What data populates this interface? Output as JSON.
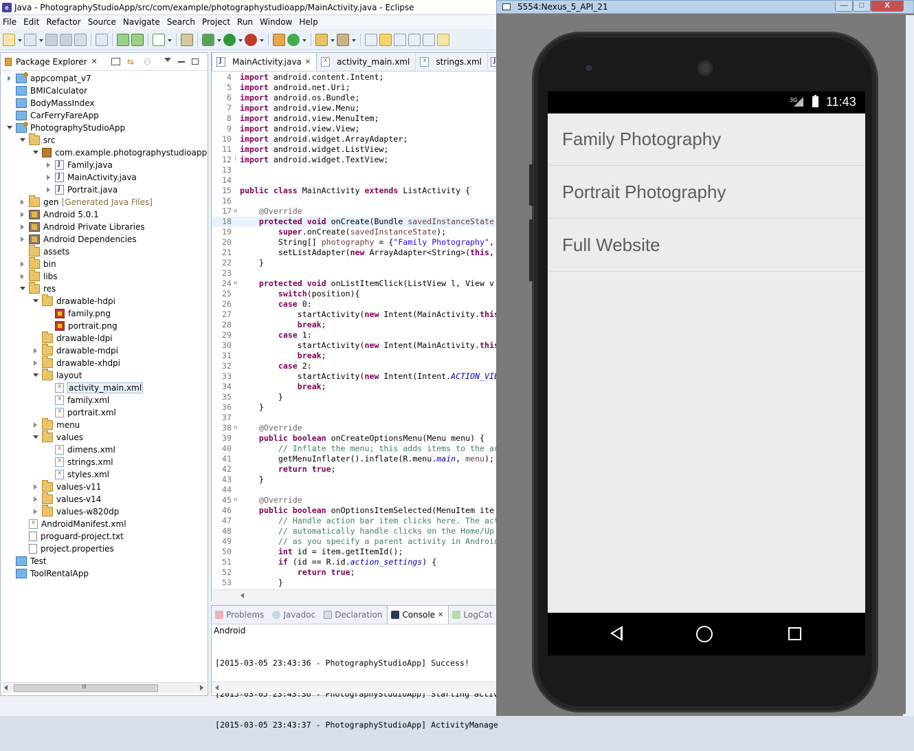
{
  "eclipse": {
    "title": "Java - PhotographyStudioApp/src/com/example/photographystudioapp/MainActivity.java - Eclipse",
    "menu": [
      "File",
      "Edit",
      "Refactor",
      "Source",
      "Navigate",
      "Search",
      "Project",
      "Run",
      "Window",
      "Help"
    ],
    "package_explorer": {
      "title": "Package Explorer",
      "tree": [
        {
          "label": "appcompat_v7",
          "icon": "project-icon"
        },
        {
          "label": "BMICalculator",
          "icon": "folder-icon"
        },
        {
          "label": "BodyMassIndex",
          "icon": "folder-icon"
        },
        {
          "label": "CarFerryFareApp",
          "icon": "folder-icon"
        },
        {
          "label": "PhotographyStudioApp",
          "icon": "project-icon"
        },
        {
          "label": "src",
          "icon": "source-folder-icon"
        },
        {
          "label": "com.example.photographystudioapp",
          "icon": "package-icon"
        },
        {
          "label": "Family.java",
          "icon": "java-file-icon"
        },
        {
          "label": "MainActivity.java",
          "icon": "java-file-icon"
        },
        {
          "label": "Portrait.java",
          "icon": "java-file-icon"
        },
        {
          "label": "gen",
          "icon": "source-folder-icon",
          "suffix": "[Generated Java Files]"
        },
        {
          "label": "Android 5.0.1",
          "icon": "library-icon"
        },
        {
          "label": "Android Private Libraries",
          "icon": "library-icon"
        },
        {
          "label": "Android Dependencies",
          "icon": "library-icon"
        },
        {
          "label": "assets",
          "icon": "folder-icon"
        },
        {
          "label": "bin",
          "icon": "folder-icon"
        },
        {
          "label": "libs",
          "icon": "folder-icon"
        },
        {
          "label": "res",
          "icon": "folder-icon"
        },
        {
          "label": "drawable-hdpi",
          "icon": "folder-icon"
        },
        {
          "label": "family.png",
          "icon": "image-file-icon"
        },
        {
          "label": "portrait.png",
          "icon": "image-file-icon"
        },
        {
          "label": "drawable-ldpi",
          "icon": "folder-icon"
        },
        {
          "label": "drawable-mdpi",
          "icon": "folder-icon"
        },
        {
          "label": "drawable-xhdpi",
          "icon": "folder-icon"
        },
        {
          "label": "layout",
          "icon": "folder-icon"
        },
        {
          "label": "activity_main.xml",
          "icon": "xml-file-icon"
        },
        {
          "label": "family.xml",
          "icon": "xml-file-icon"
        },
        {
          "label": "portrait.xml",
          "icon": "xml-file-icon"
        },
        {
          "label": "menu",
          "icon": "folder-icon"
        },
        {
          "label": "values",
          "icon": "folder-icon"
        },
        {
          "label": "dimens.xml",
          "icon": "xml-file-icon"
        },
        {
          "label": "strings.xml",
          "icon": "xml-file-icon"
        },
        {
          "label": "styles.xml",
          "icon": "xml-file-icon"
        },
        {
          "label": "values-v11",
          "icon": "folder-icon"
        },
        {
          "label": "values-v14",
          "icon": "folder-icon"
        },
        {
          "label": "values-w820dp",
          "icon": "folder-icon"
        },
        {
          "label": "AndroidManifest.xml",
          "icon": "xml-file-icon"
        },
        {
          "label": "proguard-project.txt",
          "icon": "text-file-icon"
        },
        {
          "label": "project.properties",
          "icon": "text-file-icon"
        },
        {
          "label": "Test",
          "icon": "folder-icon"
        },
        {
          "label": "ToolRentalApp",
          "icon": "folder-icon"
        }
      ],
      "scroll_label": "III"
    },
    "editor": {
      "tabs": [
        "MainActivity.java",
        "activity_main.xml",
        "strings.xml"
      ],
      "lines": [
        {
          "n": "4",
          "t": "import android.content.Intent;"
        },
        {
          "n": "5",
          "t": "import android.net.Uri;"
        },
        {
          "n": "6",
          "t": "import android.os.Bundle;"
        },
        {
          "n": "7",
          "t": "import android.view.Menu;"
        },
        {
          "n": "8",
          "t": "import android.view.MenuItem;"
        },
        {
          "n": "9",
          "t": "import android.view.View;"
        },
        {
          "n": "10",
          "t": "import android.widget.ArrayAdapter;"
        },
        {
          "n": "11",
          "t": "import android.widget.ListView;"
        },
        {
          "n": "12",
          "t": "import android.widget.TextView;"
        },
        {
          "n": "13",
          "t": ""
        },
        {
          "n": "14",
          "t": ""
        },
        {
          "n": "15",
          "t": "public class MainActivity extends ListActivity {"
        },
        {
          "n": "16",
          "t": ""
        },
        {
          "n": "17",
          "t": "    @Override"
        },
        {
          "n": "18",
          "t": "    protected void onCreate(Bundle savedInstanceState"
        },
        {
          "n": "19",
          "t": "        super.onCreate(savedInstanceState);"
        },
        {
          "n": "20",
          "t": "        String[] photography = {\"Family Photography\","
        },
        {
          "n": "21",
          "t": "        setListAdapter(new ArrayAdapter<String>(this,"
        },
        {
          "n": "22",
          "t": "    }"
        },
        {
          "n": "23",
          "t": ""
        },
        {
          "n": "24",
          "t": "    protected void onListItemClick(ListView l, View v"
        },
        {
          "n": "25",
          "t": "        switch(position){"
        },
        {
          "n": "26",
          "t": "        case 0:"
        },
        {
          "n": "27",
          "t": "            startActivity(new Intent(MainActivity.this"
        },
        {
          "n": "28",
          "t": "            break;"
        },
        {
          "n": "29",
          "t": "        case 1:"
        },
        {
          "n": "30",
          "t": "            startActivity(new Intent(MainActivity.this"
        },
        {
          "n": "31",
          "t": "            break;"
        },
        {
          "n": "32",
          "t": "        case 2:"
        },
        {
          "n": "33",
          "t": "            startActivity(new Intent(Intent.ACTION_VIE"
        },
        {
          "n": "34",
          "t": "            break;"
        },
        {
          "n": "35",
          "t": "        }"
        },
        {
          "n": "36",
          "t": "    }"
        },
        {
          "n": "37",
          "t": ""
        },
        {
          "n": "38",
          "t": "    @Override"
        },
        {
          "n": "39",
          "t": "    public boolean onCreateOptionsMenu(Menu menu) {"
        },
        {
          "n": "40",
          "t": "        // Inflate the menu; this adds items to the ac"
        },
        {
          "n": "41",
          "t": "        getMenuInflater().inflate(R.menu.main, menu);"
        },
        {
          "n": "42",
          "t": "        return true;"
        },
        {
          "n": "43",
          "t": "    }"
        },
        {
          "n": "44",
          "t": ""
        },
        {
          "n": "45",
          "t": "    @Override"
        },
        {
          "n": "46",
          "t": "    public boolean onOptionsItemSelected(MenuItem ite"
        },
        {
          "n": "47",
          "t": "        // Handle action bar item clicks here. The act"
        },
        {
          "n": "48",
          "t": "        // automatically handle clicks on the Home/Up"
        },
        {
          "n": "49",
          "t": "        // as you specify a parent activity in Android"
        },
        {
          "n": "50",
          "t": "        int id = item.getItemId();"
        },
        {
          "n": "51",
          "t": "        if (id == R.id.action_settings) {"
        },
        {
          "n": "52",
          "t": "            return true;"
        },
        {
          "n": "53",
          "t": "        }"
        }
      ]
    },
    "console": {
      "tabs": [
        "Problems",
        "Javadoc",
        "Declaration",
        "Console",
        "LogCat"
      ],
      "active_tab": "Console",
      "source": "Android",
      "lines": [
        "[2015-03-05 23:43:36 - PhotographyStudioApp] Success!",
        "[2015-03-05 23:43:36 - PhotographyStudioApp] Starting activ",
        "[2015-03-05 23:43:37 - PhotographyStudioApp] ActivityManage"
      ]
    }
  },
  "emulator": {
    "title": "5554:Nexus_5_API_21",
    "window_buttons": {
      "minimize": "—",
      "maximize": "□",
      "close": "X"
    },
    "status_bar": {
      "network": "3G",
      "time": "11:43"
    },
    "list_items": [
      "Family Photography",
      "Portrait Photography",
      "Full Website"
    ],
    "nav": {
      "back": "back-icon",
      "home": "home-icon",
      "recents": "recents-icon"
    }
  },
  "colors": {
    "keyword": "#7f0055",
    "string": "#2a00ff",
    "comment": "#3f7f5f",
    "annotation": "#646464",
    "field": "#0000c0",
    "list_text": "#5d5d5d",
    "list_bg": "#ececec",
    "emulator_bg": "#7a7a7a"
  }
}
